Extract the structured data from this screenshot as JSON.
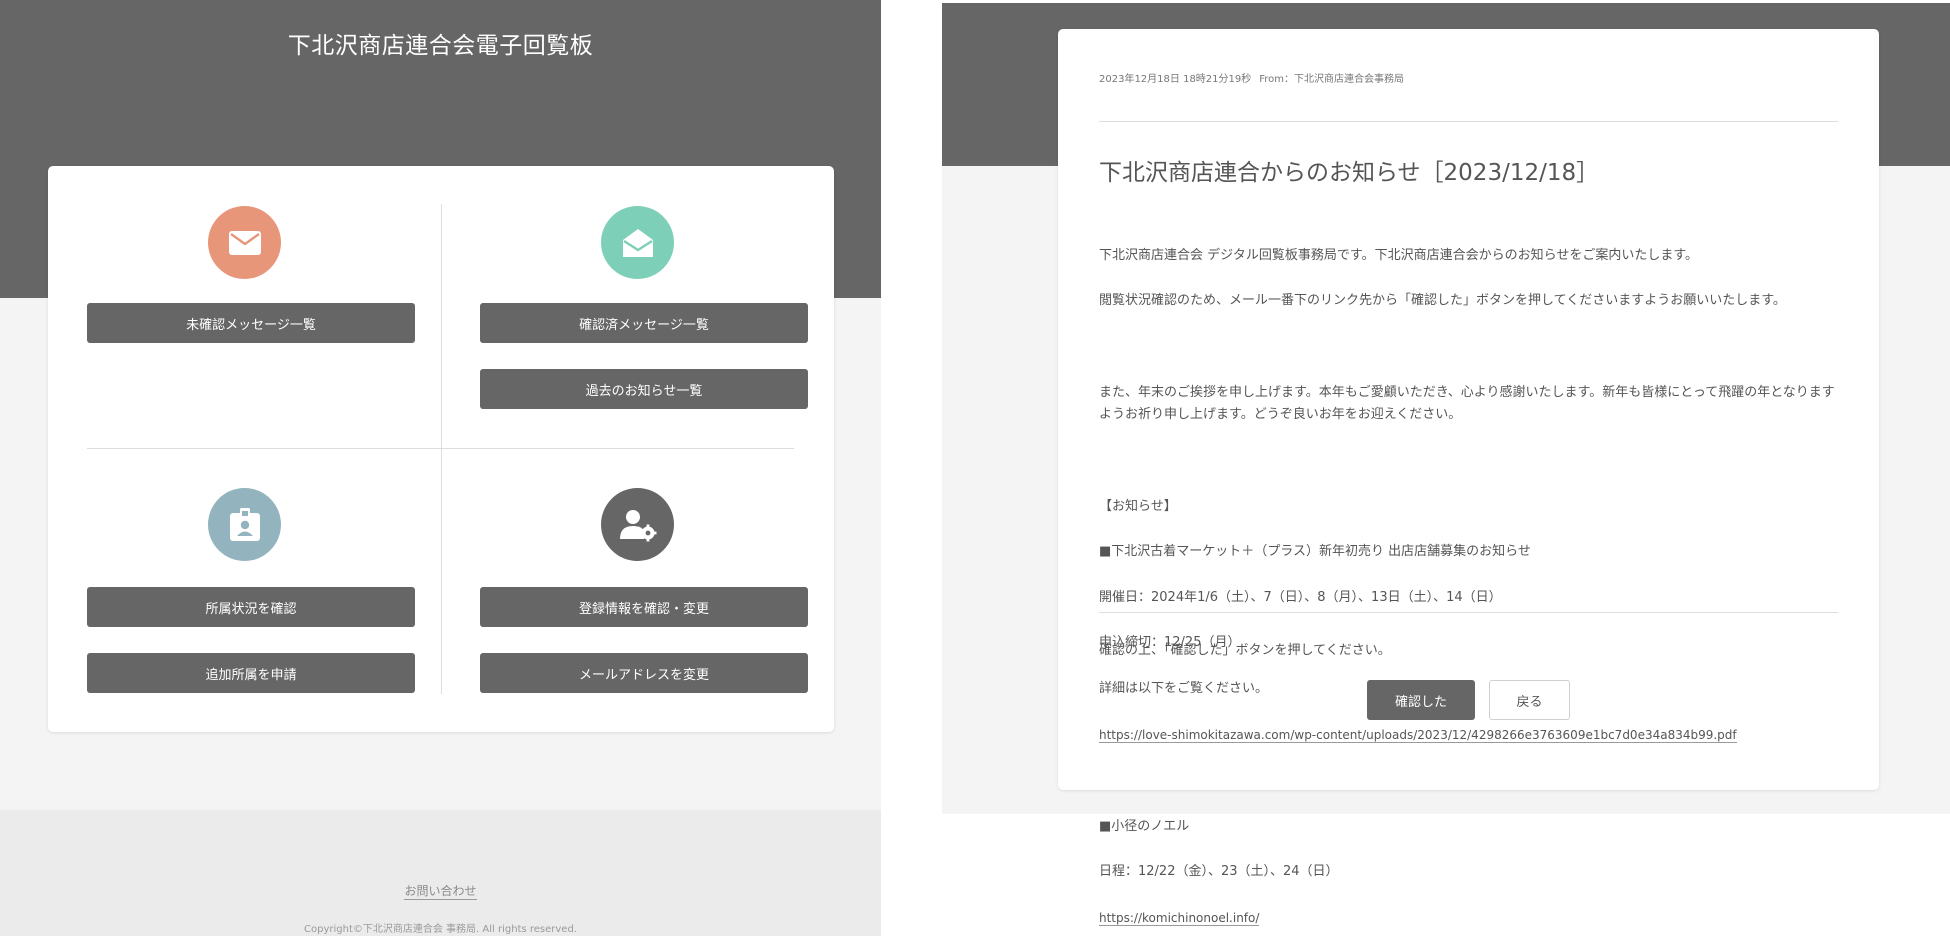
{
  "menu_screen": {
    "site_title": "下北沢商店連合会電子回覧板",
    "buttons": {
      "unread": "未確認メッセージ一覧",
      "read": "確認済メッセージ一覧",
      "past_notices": "過去のお知らせ一覧",
      "affiliation_status": "所属状況を確認",
      "add_affiliation": "追加所属を申請",
      "edit_registration": "登録情報を確認・変更",
      "change_email": "メールアドレスを変更"
    },
    "icons": {
      "unread": {
        "name": "envelope-closed-icon",
        "color": "#e8967a"
      },
      "read": {
        "name": "envelope-open-icon",
        "color": "#7ecfb7"
      },
      "affiliation": {
        "name": "id-badge-icon",
        "color": "#93b4bf"
      },
      "settings": {
        "name": "user-settings-icon",
        "color": "#666666"
      }
    },
    "footer": {
      "contact_link": "お問い合わせ",
      "copyright": "Copyright©下北沢商店連合会 事務局. All rights reserved."
    }
  },
  "message_screen": {
    "meta": {
      "date": "2023年12月18日 18時21分19秒",
      "from": "From：下北沢商店連合会事務局"
    },
    "title": "下北沢商店連合からのお知らせ［2023/12/18］",
    "body": {
      "intro_1": "下北沢商店連合会 デジタル回覧板事務局です。下北沢商店連合会からのお知らせをご案内いたします。",
      "intro_2": "閲覧状況確認のため、メール一番下のリンク先から「確認した」ボタンを押してくださいますようお願いいたします。",
      "greeting": "また、年末のご挨拶を申し上げます。本年もご愛顧いただき、心より感謝いたします。新年も皆様にとって飛躍の年となりますようお祈り申し上げます。どうぞ良いお年をお迎えください。",
      "notice_header": "【お知らせ】",
      "item1_title": "■下北沢古着マーケット＋（プラス）新年初売り 出店店舗募集のお知らせ",
      "item1_dates": "開催日：2024年1/6（土）、7（日）、8（月）、13日（土）、14（日）",
      "item1_deadline": "申込締切：12/25（月）",
      "item1_details": "詳細は以下をご覧ください。",
      "item1_link": "https://love-shimokitazawa.com/wp-content/uploads/2023/12/4298266e3763609e1bc7d0e34a834b99.pdf",
      "item2_title": "■小径のノエル",
      "item2_dates": "日程：12/22（金）、23（土）、24（日）",
      "item2_link": "https://komichinonoel.info/"
    },
    "instruction": "確認の上、「確認した」ボタンを押してください。",
    "confirm_button": "確認した",
    "back_button": "戻る"
  }
}
